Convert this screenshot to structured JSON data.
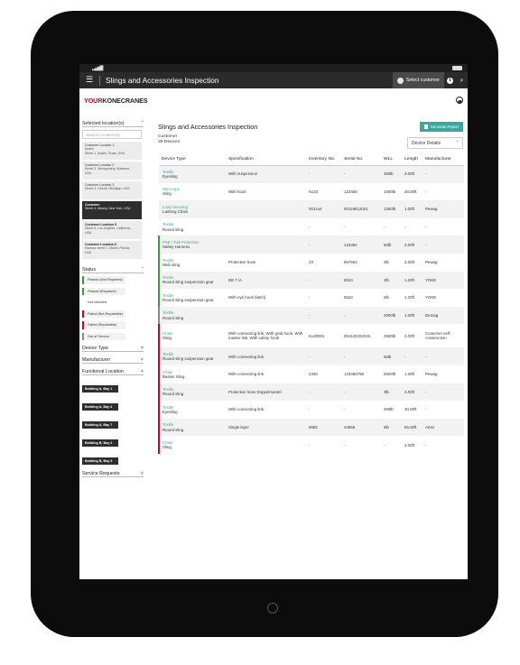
{
  "app": {
    "title": "Slings and Accessories Inspection",
    "select_customer": "Select customer",
    "logo_your": "YOUR",
    "logo_brand": "KONECRANES"
  },
  "sidebar": {
    "selected_locations_label": "Selected location(s)",
    "search_placeholder": "Search Location(s)...",
    "locations": [
      {
        "name": "Customer Location 1,",
        "line2": "Austin",
        "line3": "Street 1, Austin, Texas, USA",
        "state": "normal"
      },
      {
        "name": "Customer Location 2",
        "line2": "Street 2, Montgomery, Alabama,",
        "line3": "USA",
        "state": "normal"
      },
      {
        "name": "Customer Location 3",
        "line2": "Street 3, Detroit, Michigan, USA",
        "line3": "",
        "state": "normal"
      },
      {
        "name": "Customer",
        "line2": "Street 4, Albany, New York, USA",
        "line3": "",
        "state": "selected"
      },
      {
        "name": "Customer Location 5",
        "line2": "Street 5, Los Angeles, California,",
        "line3": "USA",
        "state": "bold"
      },
      {
        "name": "Customer Location 6",
        "line2": "Harbour street 1, Miami, Florida,",
        "line3": "USA",
        "state": "bold"
      }
    ],
    "status_label": "Status",
    "statuses": [
      {
        "label": "Passed (Not Repaired)",
        "color": "green"
      },
      {
        "label": "Passed (Repaired)",
        "color": "green"
      },
      {
        "label": "Not checked",
        "color": "none"
      },
      {
        "label": "Failed (Not Repairable)",
        "color": "red"
      },
      {
        "label": "Failed (Repairable)",
        "color": "red"
      },
      {
        "label": "Out of Service",
        "color": "grey"
      }
    ],
    "device_type_label": "Device Type",
    "manufacturer_label": "Manufacturer",
    "functional_location_label": "Functional Location",
    "functional_locations": [
      "Building A, Bay 1",
      "Building A, Bay 4",
      "Building A, Bay 7",
      "Building B, Bay 2",
      "Building B, Bay 3"
    ],
    "service_requests_label": "Service Requests"
  },
  "main": {
    "title": "Slings and Accessories Inspection",
    "generate_report": "Generate Report",
    "customer_label": "Customer",
    "devices_count": "39 Devices",
    "details_dropdown": "Device Details",
    "columns": [
      "Device Type",
      "Specification",
      "Inventory No.",
      "Serial No.",
      "WLL",
      "Length",
      "Manufacturer"
    ],
    "rows": [
      {
        "status": "none",
        "name": "Textile",
        "type": "Eyesling",
        "spec": "With suspension",
        "inv": "-",
        "serial": "-",
        "wll": "300lb",
        "length": "3.00ft",
        "mfr": "-"
      },
      {
        "status": "none",
        "name": "Wire rope",
        "type": "Sling",
        "spec": "With hook",
        "inv": "N123",
        "serial": "123456",
        "wll": "1000lb",
        "length": "30.00ft",
        "mfr": "-"
      },
      {
        "status": "none",
        "name": "Load Securing",
        "type": "Lashing Chain",
        "spec": "",
        "inv": "001zurr",
        "serial": "00119012021",
        "wll": "1250lb",
        "length": "1.00ft",
        "mfr": "Pewag"
      },
      {
        "status": "none",
        "name": "Textile",
        "type": "Round sling",
        "spec": "",
        "inv": "-",
        "serial": "-",
        "wll": "-",
        "length": "-",
        "mfr": "-"
      },
      {
        "status": "green",
        "name": "PSE / Fall Protection",
        "type": "Safety Harness",
        "spec": "",
        "inv": "-",
        "serial": "12345s",
        "wll": "50lb",
        "length": "2.00ft",
        "mfr": "-"
      },
      {
        "status": "green",
        "name": "Textile",
        "type": "Web sling",
        "spec": "Protective hose",
        "inv": "23",
        "serial": "667664",
        "wll": "4lb",
        "length": "2.00ft",
        "mfr": "Pewag"
      },
      {
        "status": "green",
        "name": "Textile",
        "type": "Round sling suspension gear",
        "spec": "EB 7 /A",
        "inv": "-",
        "serial": "6510",
        "wll": "2lb",
        "length": "1.20ft",
        "mfr": "YOKE"
      },
      {
        "status": "green",
        "name": "Textile",
        "type": "Round sling suspension gear",
        "spec": "With eye hook (latch)",
        "inv": "-",
        "serial": "5510",
        "wll": "2lb",
        "length": "1.20ft",
        "mfr": "YOKE"
      },
      {
        "status": "grey",
        "name": "Textile",
        "type": "Round sling",
        "spec": "",
        "inv": "-",
        "serial": "-",
        "wll": "2000lb",
        "length": "1.00ft",
        "mfr": "Demag"
      },
      {
        "status": "red",
        "name": "Chain",
        "type": "Sling",
        "spec": "With connecting link, With grab hook, With master link, With safety hook",
        "inv": "Kcd0001",
        "serial": "051120202015",
        "wll": "2900lb",
        "length": "2.00ft",
        "mfr": "Customer self-construction"
      },
      {
        "status": "red",
        "name": "Textile",
        "type": "Round sling suspension gear",
        "spec": "With connecting link",
        "inv": "-",
        "serial": "-",
        "wll": "65lb",
        "length": "-",
        "mfr": "-"
      },
      {
        "status": "red",
        "name": "Chain",
        "type": "Basket Sling",
        "spec": "With connecting link",
        "inv": "2345",
        "serial": "123456789",
        "wll": "2500lb",
        "length": "1.00ft",
        "mfr": "Pewag"
      },
      {
        "status": "red",
        "name": "Textile",
        "type": "Round sling",
        "spec": "Protective hose Doppelmantel",
        "inv": "-",
        "serial": "-",
        "wll": "3lb",
        "length": "2.00ft",
        "mfr": "-"
      },
      {
        "status": "red",
        "name": "Textile",
        "type": "Eyesling",
        "spec": "With connecting link",
        "inv": "-",
        "serial": "-",
        "wll": "300lb",
        "length": "30.00ft",
        "mfr": "-"
      },
      {
        "status": "red",
        "name": "Textile",
        "type": "Round sling",
        "spec": "Single layer",
        "inv": "6655",
        "serial": "44556",
        "wll": "6lb",
        "length": "55.00ft",
        "mfr": "Artex"
      },
      {
        "status": "red",
        "name": "Chain",
        "type": "Sling",
        "spec": "",
        "inv": "-",
        "serial": "-",
        "wll": "-",
        "length": "2.00ft",
        "mfr": "-"
      }
    ]
  }
}
